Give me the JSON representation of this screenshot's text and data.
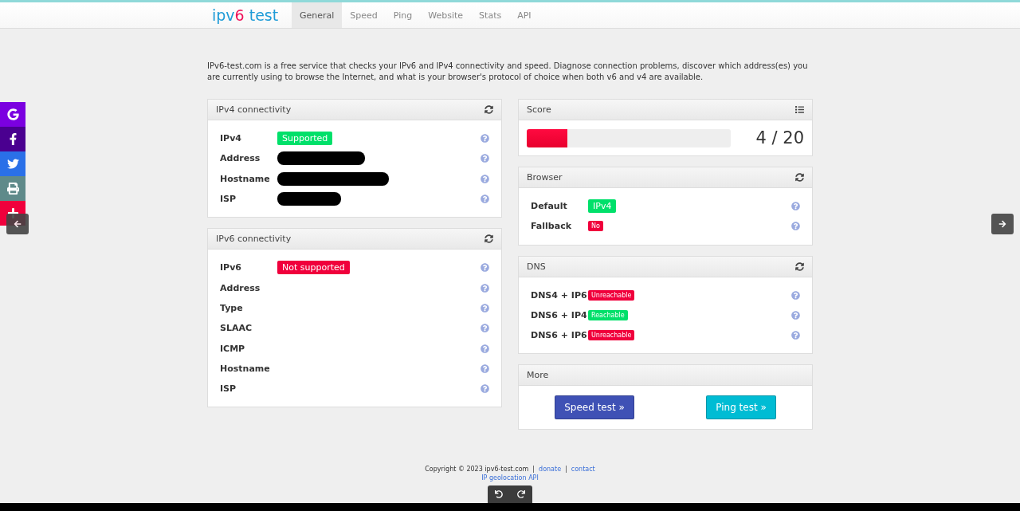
{
  "header": {
    "logo": {
      "prefix": "ipv",
      "digit": "6",
      "suffix": " test"
    },
    "tabs": [
      {
        "label": "General",
        "selected": true
      },
      {
        "label": "Speed",
        "selected": false
      },
      {
        "label": "Ping",
        "selected": false
      },
      {
        "label": "Website",
        "selected": false
      },
      {
        "label": "Stats",
        "selected": false
      },
      {
        "label": "API",
        "selected": false
      }
    ]
  },
  "intro": "IPv6-test.com is a free service that checks your IPv6 and IPv4 connectivity and speed. Diagnose connection problems, discover which address(es) you are currently using to browse the Internet, and what is your browser's protocol of choice when both v6 and v4 are available.",
  "left_panels": [
    {
      "title": "IPv4 connectivity",
      "rows": [
        {
          "label": "IPv4",
          "kind": "badge",
          "value": "Supported",
          "color": "#00e06a"
        },
        {
          "label": "Address",
          "kind": "redacted"
        },
        {
          "label": "Hostname",
          "kind": "redacted"
        },
        {
          "label": "ISP",
          "kind": "redacted"
        }
      ]
    },
    {
      "title": "IPv6 connectivity",
      "rows": [
        {
          "label": "IPv6",
          "kind": "badge",
          "value": "Not supported",
          "color": "#f0003c"
        },
        {
          "label": "Address",
          "kind": "empty"
        },
        {
          "label": "Type",
          "kind": "empty"
        },
        {
          "label": "SLAAC",
          "kind": "empty"
        },
        {
          "label": "ICMP",
          "kind": "empty"
        },
        {
          "label": "Hostname",
          "kind": "empty"
        },
        {
          "label": "ISP",
          "kind": "empty"
        }
      ]
    }
  ],
  "score": {
    "title": "Score",
    "level": 0.2,
    "reading": "4 / 20"
  },
  "browser": {
    "title": "Browser",
    "rows": [
      {
        "label": "Default",
        "kind": "badge",
        "value": "IPv4",
        "color": "#00e06a"
      },
      {
        "label": "Fallback",
        "kind": "small",
        "value": "No",
        "color": "#f0003c"
      }
    ]
  },
  "dns": {
    "title": "DNS",
    "rows": [
      {
        "label": "DNS4 + IP6",
        "kind": "small",
        "value": "Unreachable",
        "color": "#f0003c"
      },
      {
        "label": "DNS6 + IP4",
        "kind": "small",
        "value": "Reachable",
        "color": "#00e06a"
      },
      {
        "label": "DNS6 + IP6",
        "kind": "small",
        "value": "Unreachable",
        "color": "#f0003c"
      }
    ]
  },
  "more": {
    "title": "More",
    "buttons": [
      {
        "label": "Speed test »",
        "color": "#3f51b5"
      },
      {
        "label": "Ping test »",
        "color": "#00bcd4"
      }
    ]
  },
  "social": [
    {
      "kind": "google",
      "color": "#7b00e0"
    },
    {
      "kind": "facebook",
      "color": "#4a0090"
    },
    {
      "kind": "twitter",
      "color": "#2a70e8"
    },
    {
      "kind": "print",
      "color": "#5f8a8a"
    },
    {
      "kind": "plus",
      "color": "#f0003c"
    }
  ],
  "footer": {
    "copyright": "Copyright © 2023 ipv6-test.com",
    "separator": "|",
    "links": [
      "donate",
      "contact"
    ],
    "second_line": "IP geolocation API"
  }
}
